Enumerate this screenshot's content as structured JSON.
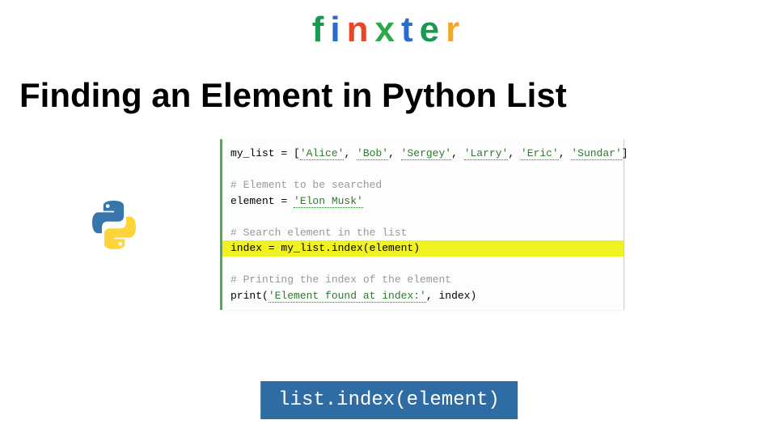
{
  "logo": {
    "letters": [
      {
        "char": "f",
        "color": "#1a9950"
      },
      {
        "char": "i",
        "color": "#2a6bcc"
      },
      {
        "char": "n",
        "color": "#e8452b"
      },
      {
        "char": "x",
        "color": "#2ea84a"
      },
      {
        "char": "t",
        "color": "#2a6bcc"
      },
      {
        "char": "e",
        "color": "#1a9950"
      },
      {
        "char": "r",
        "color": "#f5a623"
      }
    ]
  },
  "title": "Finding an Element in Python List",
  "code": {
    "line1_pre": "my_list = [",
    "line1_items": [
      "'Alice'",
      "'Bob'",
      "'Sergey'",
      "'Larry'",
      "'Eric'",
      "'Sundar'"
    ],
    "line1_post": "]",
    "line2": "",
    "line3": "# Element to be searched",
    "line4_pre": "element = ",
    "line4_val": "'Elon Musk'",
    "line5": "",
    "line6": "# Search element in the list",
    "line7": "index = my_list.index(element)",
    "line8": "",
    "line9": "# Printing the index of the element",
    "line10_pre": "print(",
    "line10_str": "'Element found at index:'",
    "line10_post": ", index)"
  },
  "footer": "list.index(element)"
}
